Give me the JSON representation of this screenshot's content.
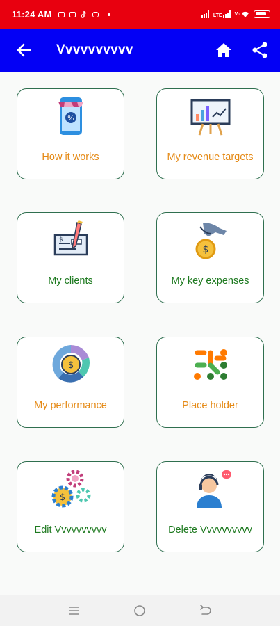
{
  "status_bar": {
    "time": "11:24 AM",
    "notification_icons": [
      "mail-icon",
      "mail-alt-icon",
      "tiktok-icon",
      "instagram-icon"
    ],
    "right_icons": [
      "signal-icon",
      "lte-signal-icon",
      "vowifi-icon",
      "battery-icon"
    ],
    "lte_label": "LTE",
    "vo_label": "Vo"
  },
  "app_bar": {
    "title": "Vvvvvvvvvv",
    "icons": [
      "back-arrow-icon",
      "home-icon",
      "share-icon"
    ]
  },
  "tiles": [
    {
      "label": "How it works",
      "icon": "percent-store-icon",
      "color": "#e58a16"
    },
    {
      "label": "My revenue targets",
      "icon": "presentation-chart-icon",
      "color": "#e58a16"
    },
    {
      "label": "My clients",
      "icon": "cheque-signing-icon",
      "color": "#1e7a20"
    },
    {
      "label": "My key expenses",
      "icon": "coin-hand-icon",
      "color": "#1e7a20"
    },
    {
      "label": "My performance",
      "icon": "coin-ring-chart-icon",
      "color": "#e58a16"
    },
    {
      "label": "Place holder",
      "icon": "dots-pattern-icon",
      "color": "#e58a16"
    },
    {
      "label": "Edit Vvvvvvvvvv",
      "icon": "coin-gears-icon",
      "color": "#1e7a20"
    },
    {
      "label": "Delete Vvvvvvvvvv",
      "icon": "support-agent-icon",
      "color": "#1e7a20"
    }
  ],
  "nav_bar": {
    "icons": [
      "recents-icon",
      "home-circle-icon",
      "back-nav-icon"
    ]
  },
  "colors": {
    "status_bar": "#e8000f",
    "app_bar": "#0300f5",
    "tile_border": "#2f6f4f",
    "label_orange": "#e58a16",
    "label_green": "#1e7a20"
  }
}
